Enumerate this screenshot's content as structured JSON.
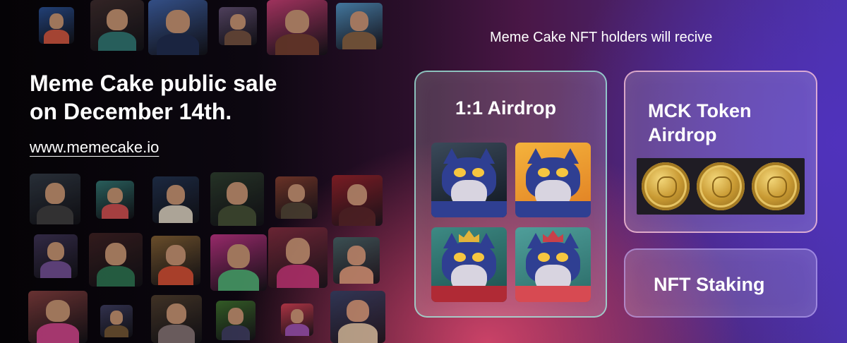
{
  "promo": {
    "headline_line1": "Meme Cake public sale",
    "headline_line2": "on December 14th.",
    "website": "www.memecake.io"
  },
  "benefits": {
    "caption": "Meme Cake NFT holders will recive",
    "airdrop_title": "1:1 Airdrop",
    "token_title_line1": "MCK Token",
    "token_title_line2": "Airdrop",
    "staking_title": "NFT Staking"
  },
  "colors": {
    "text": "#ffffff",
    "background_left": "#050306",
    "background_right": "#4a33a8",
    "accent_pink": "#e24a6e",
    "coin_gold": "#c99a33"
  },
  "images": {
    "cat_nfts": [
      "cat-nft-1",
      "cat-nft-2",
      "cat-nft-king",
      "cat-nft-robe"
    ],
    "coins": [
      "mck-coin-1",
      "mck-coin-2",
      "mck-coin-3"
    ]
  }
}
